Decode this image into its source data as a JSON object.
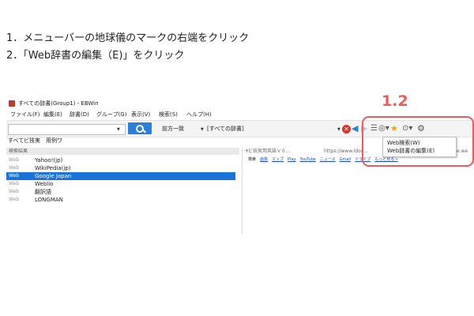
{
  "instructions": [
    "1．メニューバーの地球儀のマークの右端をクリック",
    "2．「Web辞書の編集（E)」をクリック"
  ],
  "step_label": "1.2",
  "window": {
    "title": "すべての辞書(Group1) - EBWin"
  },
  "menu": [
    "ファイル(F)",
    "編集(E)",
    "辞書(D)",
    "グループ(G)",
    "表示(V)",
    "検索(S)",
    "ヘルプ(H)"
  ],
  "toolbar": {
    "search_value": "",
    "mode": "前方一致",
    "dictionary": "[すべての辞書]"
  },
  "tabs": [
    "すべて",
    "ビ技実",
    "用例ワ"
  ],
  "result_header": "検索結果",
  "results": [
    {
      "source": "Web",
      "name": "Yahoo!(jp)",
      "selected": false
    },
    {
      "source": "Web",
      "name": "WikiPedia(jp)",
      "selected": false
    },
    {
      "source": "Web",
      "name": "Google Japan",
      "selected": true
    },
    {
      "source": "Web",
      "name": "Weblio",
      "selected": false
    },
    {
      "source": "Web",
      "name": "翻訳語",
      "selected": false
    },
    {
      "source": "Web",
      "name": "LONGMAN",
      "selected": false
    }
  ],
  "right_pane": {
    "header_title": "ビ技実用英語Ｖ６...",
    "url": "https://www.ldoc...",
    "url_suffix": "e.we",
    "links": [
      "検索",
      "画像",
      "マップ",
      "Play",
      "YouTube",
      "ニュース",
      "Gmail",
      "ドライブ",
      "もっと見る »"
    ]
  },
  "popup_menu": [
    "Web検索(W)",
    "Web辞書の編集(E)"
  ],
  "colors": {
    "accent_red": "#ee5b5b",
    "selection_blue": "#1a73d9",
    "search_button": "#2c7fd8"
  },
  "icons": [
    "app-icon",
    "search-icon",
    "clear-icon",
    "back-arrow-icon",
    "forward-arrow-icon",
    "list-icon",
    "globe-icon",
    "star-icon",
    "history-icon",
    "gear-icon"
  ]
}
